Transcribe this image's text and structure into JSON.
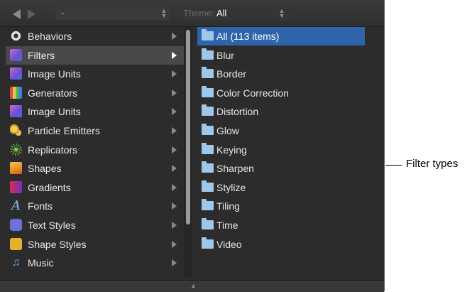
{
  "toolbar": {
    "path_value": "-",
    "theme_label": "Theme:",
    "theme_value": "All"
  },
  "categories": [
    {
      "label": "Behaviors",
      "icon": "gear-icon",
      "selected": false
    },
    {
      "label": "Filters",
      "icon": "filters-icon",
      "selected": true
    },
    {
      "label": "Image Units",
      "icon": "image-units-icon",
      "selected": false
    },
    {
      "label": "Generators",
      "icon": "generators-icon",
      "selected": false
    },
    {
      "label": "Image Units",
      "icon": "image-units-icon",
      "selected": false
    },
    {
      "label": "Particle Emitters",
      "icon": "particle-emitters-icon",
      "selected": false
    },
    {
      "label": "Replicators",
      "icon": "replicators-icon",
      "selected": false
    },
    {
      "label": "Shapes",
      "icon": "shapes-icon",
      "selected": false
    },
    {
      "label": "Gradients",
      "icon": "gradients-icon",
      "selected": false
    },
    {
      "label": "Fonts",
      "icon": "fonts-icon",
      "selected": false
    },
    {
      "label": "Text Styles",
      "icon": "text-styles-icon",
      "selected": false
    },
    {
      "label": "Shape Styles",
      "icon": "shape-styles-icon",
      "selected": false
    },
    {
      "label": "Music",
      "icon": "music-icon",
      "selected": false
    }
  ],
  "filter_folders": [
    {
      "label": "All (113 items)",
      "selected": true
    },
    {
      "label": "Blur",
      "selected": false
    },
    {
      "label": "Border",
      "selected": false
    },
    {
      "label": "Color Correction",
      "selected": false
    },
    {
      "label": "Distortion",
      "selected": false
    },
    {
      "label": "Glow",
      "selected": false
    },
    {
      "label": "Keying",
      "selected": false
    },
    {
      "label": "Sharpen",
      "selected": false
    },
    {
      "label": "Stylize",
      "selected": false
    },
    {
      "label": "Tiling",
      "selected": false
    },
    {
      "label": "Time",
      "selected": false
    },
    {
      "label": "Video",
      "selected": false
    }
  ],
  "callout": {
    "label": "Filter types"
  },
  "colors": {
    "panel_bg": "#2c2c2c",
    "selection_blue": "#2f64ac",
    "folder": "#9fc7ea"
  }
}
